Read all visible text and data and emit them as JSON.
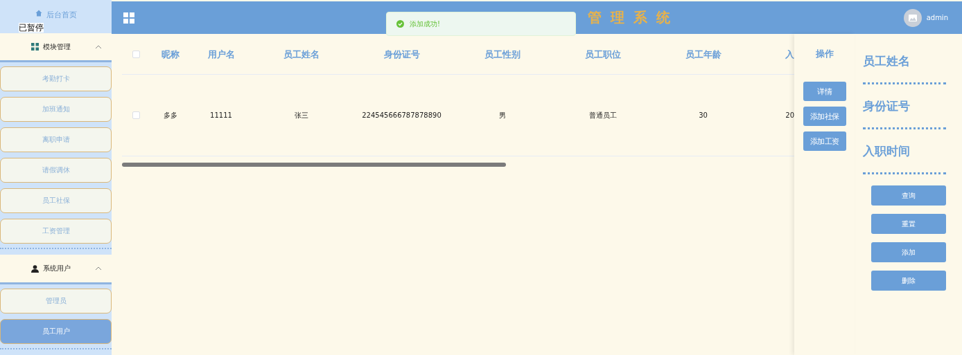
{
  "sidebar": {
    "home": "后台首页",
    "paused_label": "已暂停",
    "groups": [
      {
        "title": "模块管理",
        "kind": "modules",
        "expanded": true,
        "items": [
          {
            "label": "考勤打卡",
            "selected": false
          },
          {
            "label": "加班通知",
            "selected": false
          },
          {
            "label": "离职申请",
            "selected": false
          },
          {
            "label": "请假调休",
            "selected": false
          },
          {
            "label": "员工社保",
            "selected": false
          },
          {
            "label": "工资管理",
            "selected": false
          }
        ]
      },
      {
        "title": "系统用户",
        "kind": "users",
        "expanded": true,
        "items": [
          {
            "label": "管理员",
            "selected": false
          },
          {
            "label": "员工用户",
            "selected": true
          }
        ]
      }
    ]
  },
  "header": {
    "title": "管理系统",
    "user": "admin"
  },
  "toast": {
    "kind": "success",
    "message": "添加成功!"
  },
  "table": {
    "all_checked": false,
    "columns": [
      "昵称",
      "用户名",
      "员工姓名",
      "身份证号",
      "员工性别",
      "员工职位",
      "员工年龄",
      "入"
    ],
    "rows": [
      {
        "checked": false,
        "cells": [
          "多多",
          "11111",
          "张三",
          "224545666787878890",
          "男",
          "普通员工",
          "30",
          "20"
        ]
      }
    ],
    "action_header": "操作",
    "actions": [
      "详情",
      "添加社保",
      "添加工资"
    ]
  },
  "search": {
    "fields": [
      "员工姓名",
      "身份证号",
      "入职时间"
    ],
    "buttons": [
      "查询",
      "重置",
      "添加",
      "删除"
    ]
  }
}
